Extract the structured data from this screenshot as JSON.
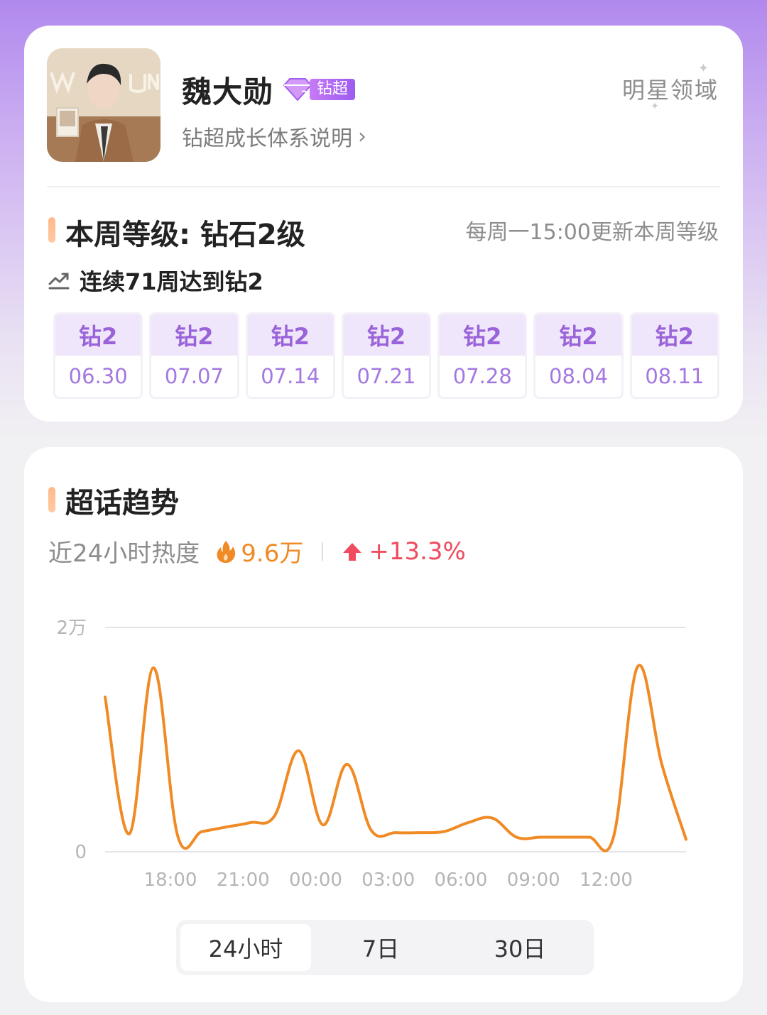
{
  "profile": {
    "name": "魏大勋",
    "badge_label": "钻超",
    "badge_level": "2",
    "growth_link": "钻超成长体系说明",
    "domain_label": "明星领域"
  },
  "weekly": {
    "title": "本周等级: 钻石2级",
    "update_note": "每周一15:00更新本周等级",
    "streak": "连续71周达到钻2",
    "weeks": [
      {
        "level": "钻2",
        "date": "06.30"
      },
      {
        "level": "钻2",
        "date": "07.07"
      },
      {
        "level": "钻2",
        "date": "07.14"
      },
      {
        "level": "钻2",
        "date": "07.21"
      },
      {
        "level": "钻2",
        "date": "07.28"
      },
      {
        "level": "钻2",
        "date": "08.04"
      },
      {
        "level": "钻2",
        "date": "08.11"
      }
    ]
  },
  "trend": {
    "title": "超话趋势",
    "heat_label": "近24小时热度",
    "heat_value": "9.6万",
    "heat_change": "+13.3%",
    "tabs": [
      "24小时",
      "7日",
      "30日"
    ],
    "active_tab": 0
  },
  "colors": {
    "line": "#f08a24",
    "accent_purple": "#9a63d9",
    "heat": "#f08a24",
    "change_up": "#f04b5e"
  },
  "chart_data": {
    "type": "line",
    "title": "",
    "xlabel": "",
    "ylabel": "",
    "ylim": [
      0,
      20000
    ],
    "y_ticks": [
      "0",
      "2万"
    ],
    "x_ticks": [
      "18:00",
      "21:00",
      "00:00",
      "03:00",
      "06:00",
      "09:00",
      "12:00"
    ],
    "x_hours": [
      18,
      21,
      24,
      27,
      30,
      33,
      36
    ],
    "grid": true,
    "series": [
      {
        "x": [
          15.3,
          16.3,
          17.3,
          18.3,
          19.3,
          20.3,
          21.3,
          22.3,
          23.3,
          24.3,
          25.3,
          26.3,
          27.3,
          28.3,
          29.3,
          30.3,
          31.3,
          32.3,
          33.3,
          34.3,
          35.3,
          36.3,
          37.3,
          38.3,
          39.3
        ],
        "values": [
          13800,
          1600,
          16400,
          1400,
          1800,
          2200,
          2600,
          3200,
          9000,
          2400,
          7800,
          1900,
          1700,
          1700,
          1800,
          2600,
          3000,
          1300,
          1300,
          1300,
          1300,
          1300,
          16500,
          7800,
          1100
        ]
      }
    ]
  }
}
